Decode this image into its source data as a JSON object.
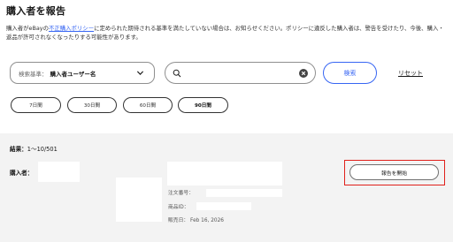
{
  "page": {
    "title": "購入者を報告",
    "description_before_link": "購入者がeBayの",
    "policy_link": "不正購入ポリシー",
    "description_after_link": "に定められた期待される基準を満たしていない場合は、お知らせください。ポリシーに違反した購入者は、警告を受けたり、今後、購入・返品が許可されなくなったりする可能性があります。"
  },
  "search": {
    "criteria_label": "検索基準：",
    "criteria_value": "購入者ユーザー名",
    "input_value": "",
    "search_button": "検索",
    "reset_link": "リセット"
  },
  "periods": {
    "options": [
      "7日間",
      "30日間",
      "60日間",
      "90日間"
    ],
    "selected": "90日間"
  },
  "results": {
    "count_label": "結果：",
    "count_value": "1〜10/501",
    "buyer_label": "購入者：",
    "order_number_label": "注文番号：",
    "item_id_label": "商品ID：",
    "sale_date_label": "販売日：",
    "sale_date_value": "Feb 16, 2026",
    "report_button": "報告を開始"
  },
  "colors": {
    "accent": "#3665f3",
    "highlight": "#e0201b",
    "results_bg": "#f3f3f3"
  },
  "icons": {
    "criteria_dropdown": "chevron-down-icon",
    "search_field": "search-icon",
    "clear_field": "clear-icon"
  }
}
